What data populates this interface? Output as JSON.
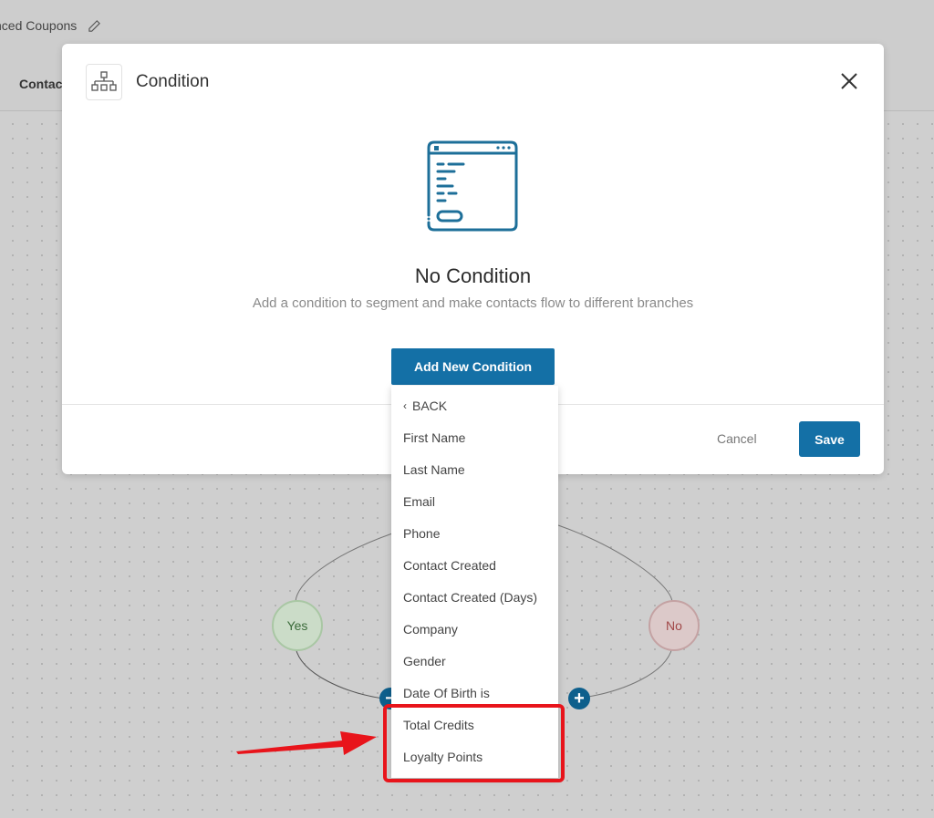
{
  "header": {
    "app_title": "nced Coupons",
    "edit_icon": "pencil-icon",
    "tab_contact": "Contact"
  },
  "modal": {
    "icon": "hierarchy-icon",
    "title": "Condition",
    "close_icon": "close-icon",
    "empty_state": {
      "illustration": "browser-window-list-icon",
      "title": "No Condition",
      "subtitle": "Add a condition to segment and make contacts flow to different branches"
    },
    "add_button": "Add New Condition",
    "cancel_button": "Cancel",
    "save_button": "Save"
  },
  "dropdown": {
    "back_label": "BACK",
    "back_icon": "chevron-left-icon",
    "items": [
      "First Name",
      "Last Name",
      "Email",
      "Phone",
      "Contact Created",
      "Contact Created (Days)",
      "Company",
      "Gender",
      "Date Of Birth is",
      "Total Credits",
      "Loyalty Points"
    ]
  },
  "flow": {
    "yes_label": "Yes",
    "no_label": "No",
    "minus_icon": "minus-icon",
    "plus_icon": "plus-icon"
  },
  "annotation": {
    "color": "#e8141b",
    "arrow_icon": "red-arrow-icon"
  },
  "colors": {
    "primary": "#1470a6",
    "yes_node": "#cbdcc8",
    "no_node": "#dcc9c9"
  }
}
